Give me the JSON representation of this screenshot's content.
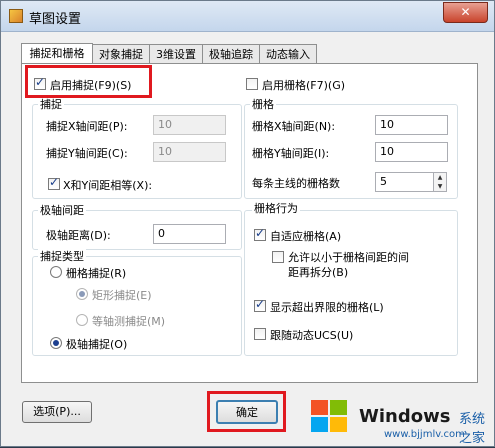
{
  "window": {
    "title": "草图设置",
    "close_glyph": "✕"
  },
  "tabs": [
    {
      "label": "捕捉和栅格"
    },
    {
      "label": "对象捕捉"
    },
    {
      "label": "3维设置"
    },
    {
      "label": "极轴追踪"
    },
    {
      "label": "动态输入"
    }
  ],
  "snap_enable": {
    "label": "启用捕捉(F9)(S)",
    "checked": true
  },
  "grid_enable": {
    "label": "启用栅格(F7)(G)",
    "checked": false
  },
  "snap_group": {
    "title": "捕捉",
    "x_spacing_label": "捕捉X轴间距(P):",
    "x_spacing_value": "10",
    "y_spacing_label": "捕捉Y轴间距(C):",
    "y_spacing_value": "10",
    "equal_label": "X和Y间距相等(X):",
    "equal_checked": true
  },
  "grid_group": {
    "title": "栅格",
    "x_spacing_label": "栅格X轴间距(N):",
    "x_spacing_value": "10",
    "y_spacing_label": "栅格Y轴间距(I):",
    "y_spacing_value": "10",
    "major_label": "每条主线的栅格数",
    "major_value": "5"
  },
  "polar_group": {
    "title": "极轴间距",
    "distance_label": "极轴距离(D):",
    "distance_value": "0"
  },
  "snap_type_group": {
    "title": "捕捉类型",
    "grid_snap_label": "栅格捕捉(R)",
    "rect_snap_label": "矩形捕捉(E)",
    "iso_snap_label": "等轴测捕捉(M)",
    "polar_snap_label": "极轴捕捉(O)",
    "selected": "polar"
  },
  "grid_behavior_group": {
    "title": "栅格行为",
    "adaptive_label": "自适应栅格(A)",
    "adaptive_checked": true,
    "subdivide_label_line1": "允许以小于栅格间距的间",
    "subdivide_label_line2": "距再拆分(B)",
    "subdivide_checked": false,
    "beyond_limits_label": "显示超出界限的栅格(L)",
    "beyond_limits_checked": true,
    "follow_ucs_label": "跟随动态UCS(U)",
    "follow_ucs_checked": false
  },
  "buttons": {
    "options_label": "选项(P)...",
    "ok_label": "确定"
  },
  "watermark": {
    "brand": "Windows",
    "cn_text": "系统之家",
    "url": "www.bjjmlv.com"
  },
  "colors": {
    "highlight": "#e0191f",
    "watermark_blue": "#1a5fa8"
  }
}
